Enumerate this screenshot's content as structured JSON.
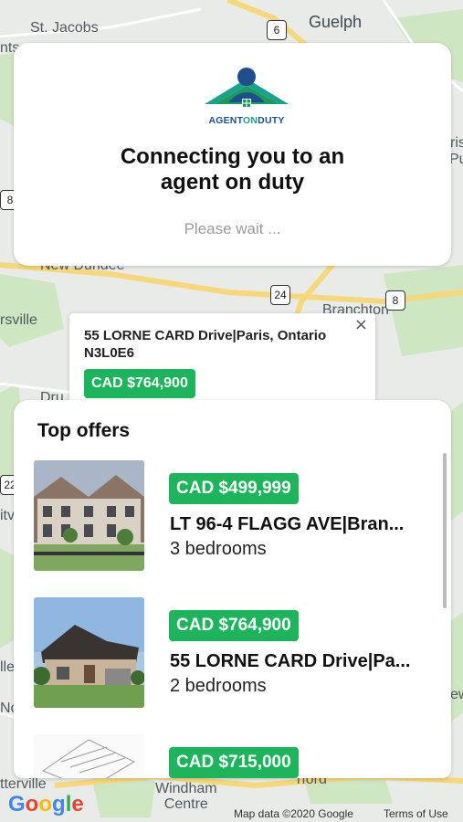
{
  "map": {
    "labels": {
      "guelph": "Guelph",
      "st_jacobs": "St. Jacobs",
      "new_dundee": "New Dundee",
      "branchton": "Branchton",
      "rsville": "rsville",
      "windham_centre": "Windham\nCentre",
      "otterville": "tterville",
      "route_6": "6",
      "route_24": "24",
      "route_8a": "8",
      "route_8b": "8",
      "route_22": "22",
      "edge_nts": "nts",
      "edge_ris": "ris",
      "edge_pu": "Pu",
      "edge_itv": "itv",
      "edge_lle": "lle",
      "edge_no": "No",
      "edge_ew": "ew",
      "edge_dru": "Dru",
      "edge_varford": "rford"
    },
    "google_logo": "Google",
    "attribution": "Map data ©2020 Google",
    "terms": "Terms of Use"
  },
  "connect": {
    "logo_text_agent": "AGENT",
    "logo_text_on": "ON",
    "logo_text_duty": "DUTY",
    "title": "Connecting you to an agent on duty",
    "subtitle": "Please wait ..."
  },
  "popup": {
    "address": "55 LORNE CARD Drive|Paris, Ontario N3L0E6",
    "close_icon": "×",
    "price": "CAD $764,900"
  },
  "offers": {
    "title": "Top offers",
    "items": [
      {
        "price": "CAD $499,999",
        "title": "LT 96-4 FLAGG AVE|Bran...",
        "bedrooms": "3 bedrooms"
      },
      {
        "price": "CAD $764,900",
        "title": "55 LORNE CARD Drive|Pa...",
        "bedrooms": "2 bedrooms"
      },
      {
        "price": "CAD $715,000",
        "title": "",
        "bedrooms": ""
      }
    ]
  },
  "colors": {
    "price_green": "#1db45c",
    "logo_blue": "#1e4f8c",
    "logo_teal": "#18a38f"
  }
}
